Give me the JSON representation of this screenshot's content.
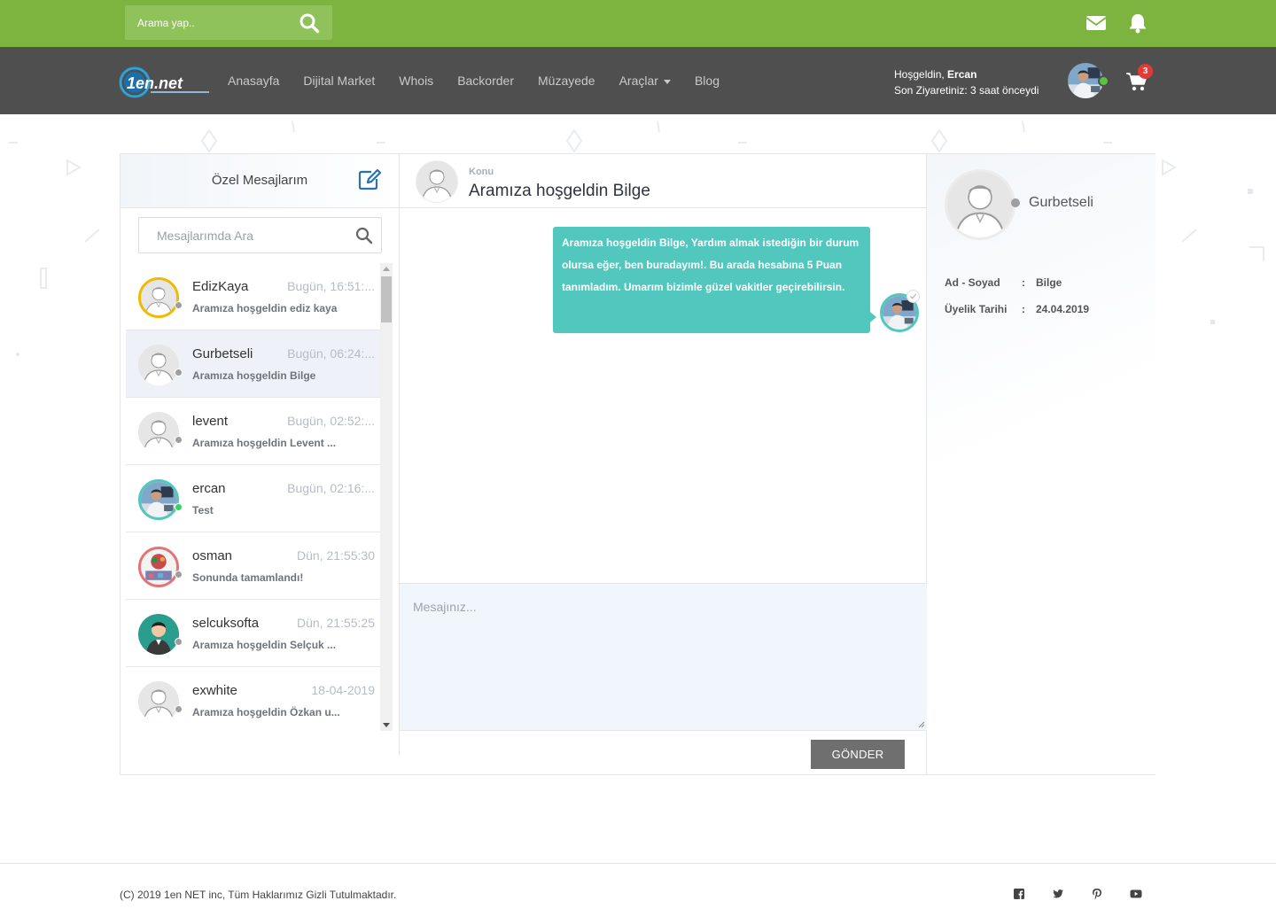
{
  "topbar": {
    "search_placeholder": "Arama yap..",
    "icons": [
      "envelope-icon",
      "bell-icon"
    ],
    "color": "#7db440"
  },
  "nav": {
    "logo_text": "1en.net",
    "links": [
      "Anasayfa",
      "Dijital Market",
      "Whois",
      "Backorder",
      "Müzayede",
      "Araçlar",
      "Blog"
    ],
    "welcome_prefix": "Hoşgeldin,",
    "welcome_user": "Ercan",
    "last_visit": "Son Ziyaretiniz: 3 saat önceydi",
    "cart_count": "3"
  },
  "sidebar": {
    "title": "Özel Mesajlarım",
    "search_placeholder": "Mesajlarımda Ara",
    "conversations": [
      {
        "name": "EdizKaya",
        "time": "Bugün, 16:51:...",
        "preview": "Aramıza hoşgeldin ediz kaya",
        "status": "offline",
        "active": false
      },
      {
        "name": "Gurbetseli",
        "time": "Bugün, 06:24:...",
        "preview": "Aramıza hoşgeldin Bilge",
        "status": "offline",
        "active": true
      },
      {
        "name": "levent",
        "time": "Bugün, 02:52:...",
        "preview": "Aramıza hoşgeldin Levent ...",
        "status": "offline",
        "active": false
      },
      {
        "name": "ercan",
        "time": "Bugün, 02:16:...",
        "preview": "Test",
        "status": "online",
        "active": false
      },
      {
        "name": "osman",
        "time": "Dün, 21:55:30",
        "preview": "Sonunda tamamlandı!",
        "status": "offline",
        "active": false
      },
      {
        "name": "selcuksofta",
        "time": "Dün, 21:55:25",
        "preview": "Aramıza hoşgeldin Selçuk ...",
        "status": "offline",
        "active": false
      },
      {
        "name": "exwhite",
        "time": "18-04-2019",
        "preview": "Aramıza hoşgeldin Özkan u...",
        "status": "offline",
        "active": false
      }
    ]
  },
  "chat": {
    "subject_label": "Konu",
    "subject": "Aramıza hoşgeldin Bilge",
    "messages": [
      {
        "text": "Aramıza hoşgeldin Bilge, Yardım almak istediğin bir durum olursa eğer, ben buradayım!. Bu arada hesabına 5 Puan tanımladım. Umarım bizimle güzel vakitler geçirebilirsin."
      }
    ],
    "compose_placeholder": "Mesajınız...",
    "send_label": "GÖNDER",
    "bubble_color": "#52c7bd"
  },
  "profile": {
    "username": "Gurbetseli",
    "fields": [
      {
        "label": "Ad - Soyad",
        "sep": ":",
        "value": "Bilge"
      },
      {
        "label": "Üyelik Tarihi",
        "sep": ":",
        "value": "24.04.2019"
      }
    ]
  },
  "footer": {
    "copyright": "(C) 2019 1en NET inc, Tüm Haklarımız Gizli Tutulmaktadır.",
    "social": [
      "facebook-icon",
      "twitter-icon",
      "pinterest-icon",
      "youtube-icon"
    ]
  }
}
